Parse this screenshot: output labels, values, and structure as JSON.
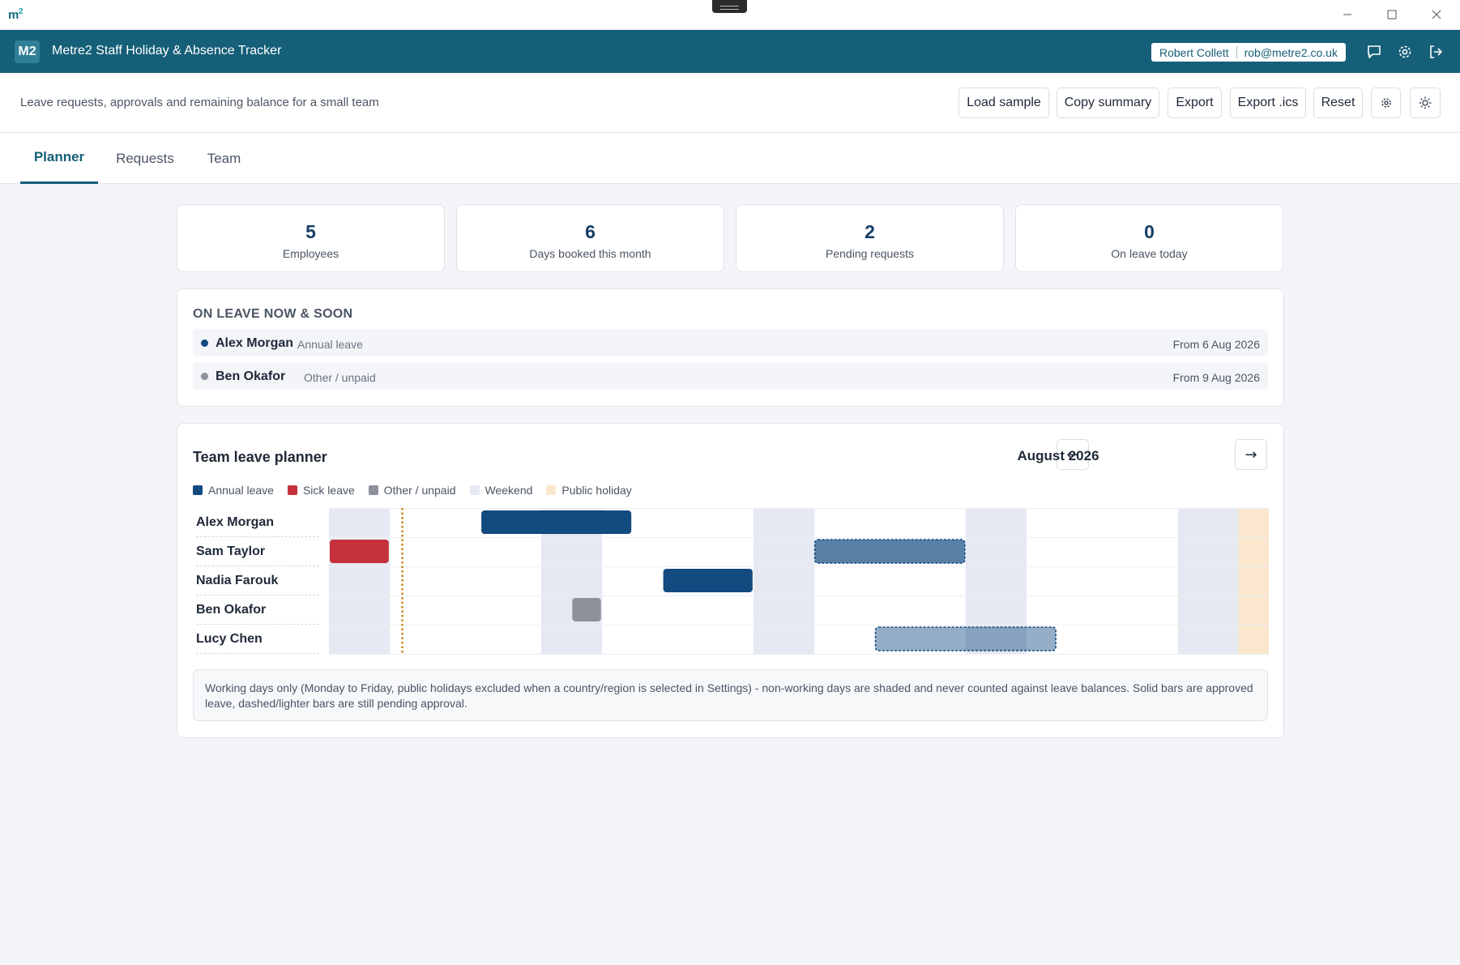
{
  "os": {
    "logo": "m2",
    "icons": [
      "minimize-icon",
      "maximize-icon",
      "close-icon"
    ]
  },
  "header": {
    "badge": "M2",
    "title": "Metre2 Staff Holiday & Absence Tracker",
    "user_name": "Robert Collett",
    "user_email": "rob@metre2.co.uk",
    "icons": [
      "chat-icon",
      "gear-icon",
      "logout-icon"
    ],
    "color": "#155f78"
  },
  "toolbar": {
    "subtitle": "Leave requests, approvals and remaining balance for a small team",
    "load_sample": "Load sample",
    "copy_summary": "Copy summary",
    "export": "Export",
    "export_ics": "Export .ics",
    "reset": "Reset",
    "icons": [
      "settings-icon",
      "theme-toggle-icon"
    ]
  },
  "tabs": [
    {
      "label": "Planner",
      "active": true
    },
    {
      "label": "Requests",
      "active": false
    },
    {
      "label": "Team",
      "active": false
    }
  ],
  "stats": [
    {
      "value": "5",
      "label": "Employees"
    },
    {
      "value": "6",
      "label": "Days booked this month"
    },
    {
      "value": "2",
      "label": "Pending requests"
    },
    {
      "value": "0",
      "label": "On leave today"
    }
  ],
  "on_leave": {
    "heading": "ON LEAVE NOW & SOON",
    "items": [
      {
        "name": "Alex Morgan",
        "type": "Annual leave",
        "date": "From 6 Aug 2026",
        "color": "#134a80"
      },
      {
        "name": "Ben Okafor",
        "type": "Other / unpaid",
        "date": "From 9 Aug 2026",
        "color": "#8c919b"
      }
    ]
  },
  "planner": {
    "title": "Team leave planner",
    "month": "August 2026",
    "prev": "←",
    "next": "→",
    "legend": [
      {
        "label": "Annual leave",
        "color": "#134a80"
      },
      {
        "label": "Sick leave",
        "color": "#c5313a"
      },
      {
        "label": "Other / unpaid",
        "color": "#8c919b"
      },
      {
        "label": "Weekend",
        "color": "#e6e9f2"
      },
      {
        "label": "Public holiday",
        "color": "#fbe7cd"
      }
    ],
    "days_in_month": 31,
    "today_day": 3,
    "weekend_days": [
      1,
      2,
      8,
      9,
      15,
      16,
      22,
      23,
      29,
      30
    ],
    "public_holiday_days": [
      31
    ],
    "employees": [
      "Alex Morgan",
      "Sam Taylor",
      "Nadia Farouk",
      "Ben Okafor",
      "Lucy Chen"
    ],
    "bars": [
      {
        "employee": 0,
        "start": 6,
        "end": 10,
        "kind": "annual",
        "status": "approved"
      },
      {
        "employee": 1,
        "start": 1,
        "end": 2,
        "kind": "sick",
        "status": "approved"
      },
      {
        "employee": 1,
        "start": 17,
        "end": 21,
        "kind": "annual",
        "status": "pending"
      },
      {
        "employee": 2,
        "start": 12,
        "end": 14,
        "kind": "annual",
        "status": "approved"
      },
      {
        "employee": 3,
        "start": 9,
        "end": 9,
        "kind": "other",
        "status": "approved"
      },
      {
        "employee": 4,
        "start": 19,
        "end": 24,
        "kind": "annual",
        "status": "pending"
      }
    ],
    "note": "Working days only (Monday to Friday, public holidays excluded when a country/region is selected in Settings) - non-working days are shaded and never counted against leave balances. Solid bars are approved leave, dashed/lighter bars are still pending approval."
  }
}
